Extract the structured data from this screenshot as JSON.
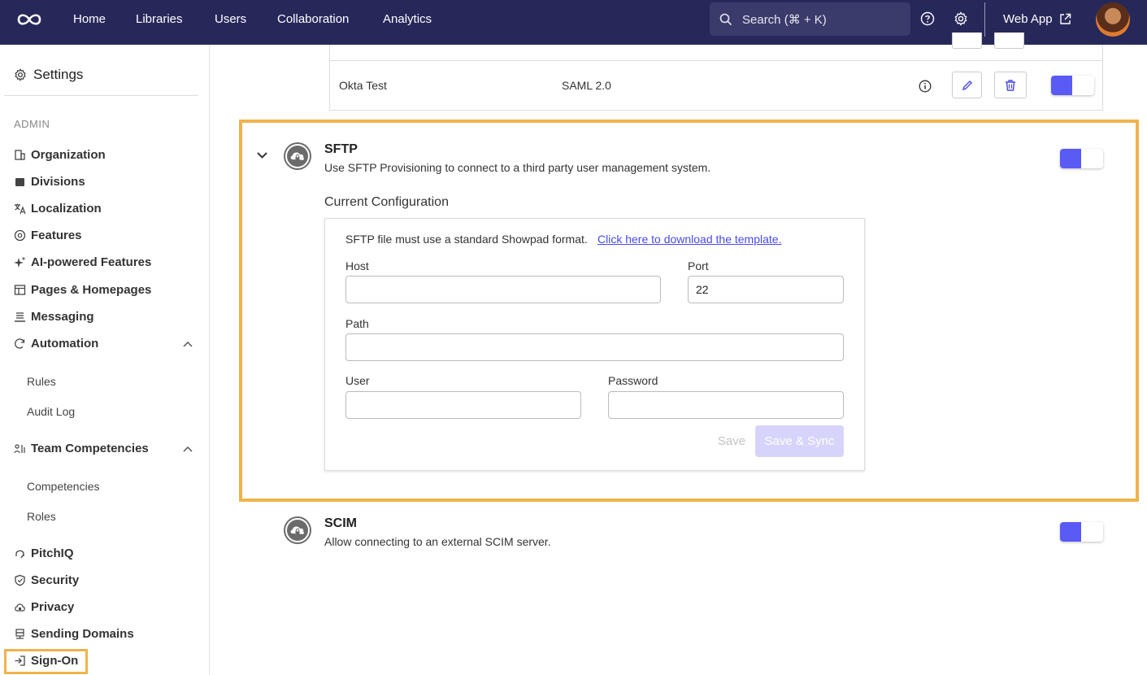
{
  "nav": {
    "items": [
      "Home",
      "Libraries",
      "Users",
      "Collaboration",
      "Analytics"
    ],
    "search_placeholder": "Search (⌘ + K)",
    "webapp_label": "Web App"
  },
  "sidebar": {
    "title": "Settings",
    "section": "ADMIN",
    "items": [
      {
        "label": "Organization",
        "icon": "building-icon"
      },
      {
        "label": "Divisions",
        "icon": "divisions-icon"
      },
      {
        "label": "Localization",
        "icon": "translate-icon"
      },
      {
        "label": "Features",
        "icon": "features-icon"
      },
      {
        "label": "AI-powered Features",
        "icon": "sparkle-icon"
      },
      {
        "label": "Pages & Homepages",
        "icon": "pages-icon"
      },
      {
        "label": "Messaging",
        "icon": "messaging-icon"
      },
      {
        "label": "Automation",
        "icon": "automation-icon"
      },
      {
        "label": "Team Competencies",
        "icon": "team-icon"
      },
      {
        "label": "PitchIQ",
        "icon": "pitchiq-icon"
      },
      {
        "label": "Security",
        "icon": "shield-icon"
      },
      {
        "label": "Privacy",
        "icon": "privacy-icon"
      },
      {
        "label": "Sending Domains",
        "icon": "server-icon"
      },
      {
        "label": "Sign-On",
        "icon": "sign-on-icon"
      }
    ],
    "automation_sub": [
      "Rules",
      "Audit Log"
    ],
    "competencies_sub": [
      "Competencies",
      "Roles"
    ]
  },
  "sso_row": {
    "name": "Okta Test",
    "protocol": "SAML 2.0",
    "enabled": true
  },
  "sftp": {
    "title": "SFTP",
    "description": "Use SFTP Provisioning to connect to a third party user management system.",
    "enabled": true,
    "config_title": "Current Configuration",
    "format_note": "SFTP file must use a standard Showpad format.",
    "template_link": "Click here to download the template.",
    "host_label": "Host",
    "host_value": "",
    "port_label": "Port",
    "port_value": "22",
    "path_label": "Path",
    "path_value": "",
    "user_label": "User",
    "user_value": "",
    "password_label": "Password",
    "password_value": "",
    "save_label": "Save",
    "save_sync_label": "Save & Sync"
  },
  "scim": {
    "title": "SCIM",
    "description": "Allow connecting to an external SCIM server.",
    "enabled": true
  },
  "colors": {
    "topbar": "#27285a",
    "accent": "#5a5af5",
    "highlight": "#f0b34b"
  }
}
